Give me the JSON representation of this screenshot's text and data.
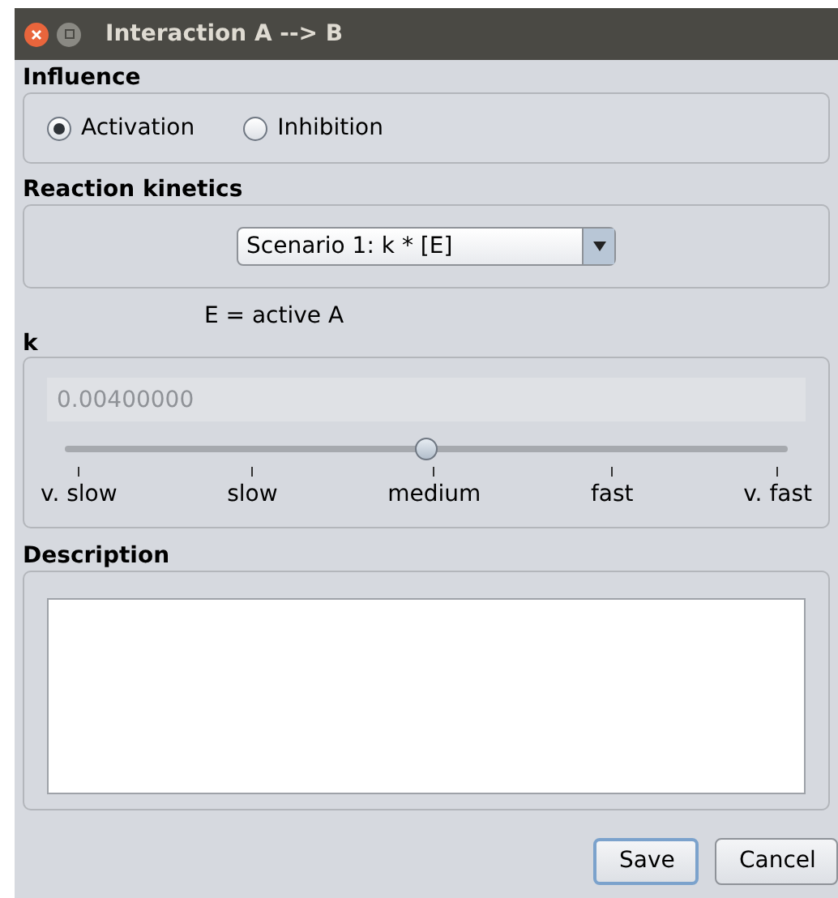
{
  "window": {
    "title": "Interaction A --> B"
  },
  "influence": {
    "label": "Influence",
    "options": [
      {
        "label": "Activation",
        "selected": true
      },
      {
        "label": "Inhibition",
        "selected": false
      }
    ]
  },
  "kinetics": {
    "label": "Reaction kinetics",
    "scenario": "Scenario 1: k * [E]",
    "note": "E = active A"
  },
  "k": {
    "label": "k",
    "value": "0.00400000",
    "disabled": true,
    "level": 0.5,
    "ticks": [
      "v. slow",
      "slow",
      "medium",
      "fast",
      "v. fast"
    ]
  },
  "description": {
    "label": "Description"
  },
  "buttons": [
    {
      "label": "Save",
      "default": true
    },
    {
      "label": "Cancel",
      "default": false
    }
  ]
}
